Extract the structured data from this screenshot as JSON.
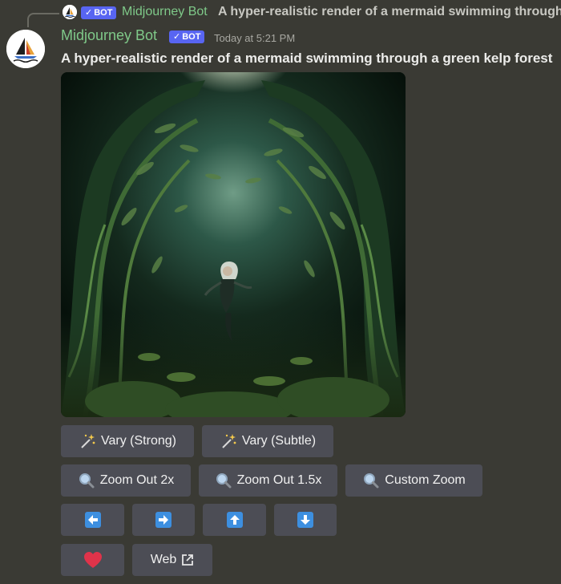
{
  "reply": {
    "author": "Midjourney Bot",
    "badge": "BOT",
    "text": "A hyper-realistic render of a mermaid swimming through a green kelp forest"
  },
  "message": {
    "author": "Midjourney Bot",
    "badge": "BOT",
    "timestamp": "Today at 5:21 PM",
    "text": "A hyper-realistic render of a mermaid swimming through a green kelp forest"
  },
  "buttons": {
    "vary_strong": "Vary (Strong)",
    "vary_subtle": "Vary (Subtle)",
    "zoom_out_2x": "Zoom Out 2x",
    "zoom_out_1_5x": "Zoom Out 1.5x",
    "custom_zoom": "Custom Zoom",
    "web": "Web"
  },
  "icons": {
    "vary": "sparkle-wand-icon",
    "zoom": "magnifier-icon",
    "pan_left": "arrow-left-icon",
    "pan_right": "arrow-right-icon",
    "pan_up": "arrow-up-icon",
    "pan_down": "arrow-down-icon",
    "favorite": "heart-icon",
    "external": "external-link-icon"
  },
  "colors": {
    "background": "#3a3a34",
    "author_name": "#7fc989",
    "badge": "#5865f2",
    "button": "#4c4d55",
    "arrow_button_icon": "#3d8fe0",
    "heart": "#e0334a"
  }
}
